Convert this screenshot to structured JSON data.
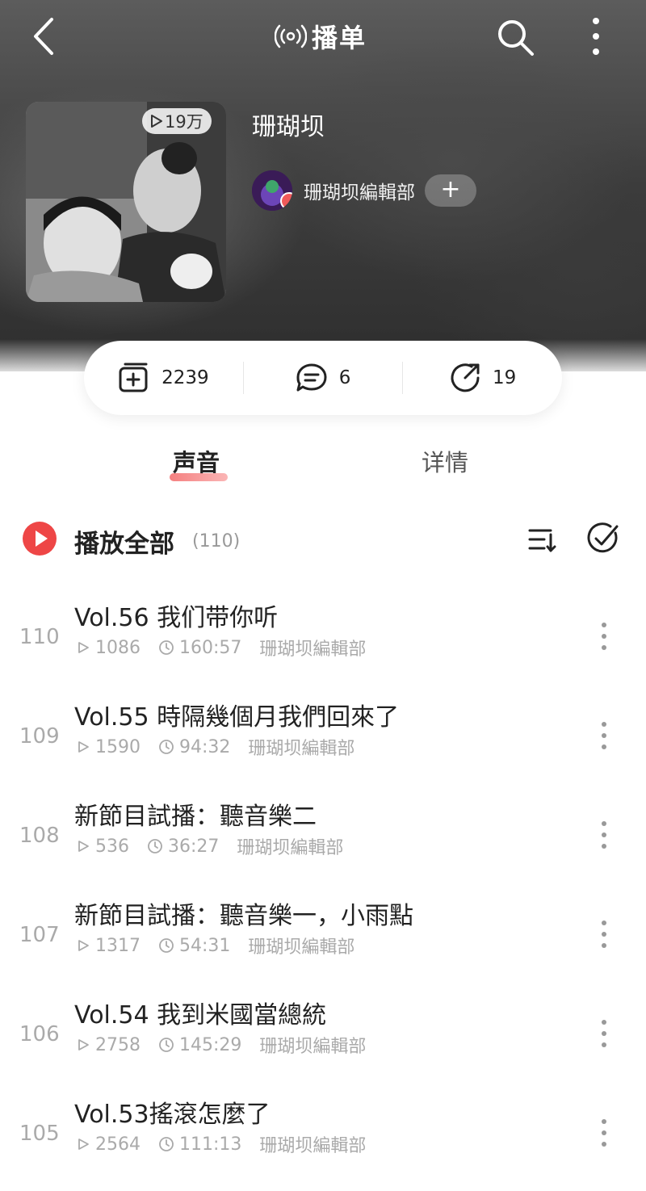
{
  "header": {
    "title": "播单"
  },
  "album": {
    "play_count": "19万",
    "name": "珊瑚坝",
    "author": "珊瑚坝編輯部",
    "follow_label": "+"
  },
  "stats": {
    "subscribe": "2239",
    "comments": "6",
    "shares": "19"
  },
  "tabs": [
    {
      "label": "声音"
    },
    {
      "label": "详情"
    }
  ],
  "play_all": {
    "label": "播放全部",
    "count": "(110)"
  },
  "tracks": [
    {
      "no": "110",
      "title": "Vol.56 我们带你听",
      "plays": "1086",
      "duration": "160:57",
      "author": "珊瑚坝編輯部"
    },
    {
      "no": "109",
      "title": "Vol.55 時隔幾個月我們回來了",
      "plays": "1590",
      "duration": "94:32",
      "author": "珊瑚坝編輯部"
    },
    {
      "no": "108",
      "title": "新節目試播：聽音樂二",
      "plays": "536",
      "duration": "36:27",
      "author": "珊瑚坝編輯部"
    },
    {
      "no": "107",
      "title": "新節目試播：聽音樂一，小雨點",
      "plays": "1317",
      "duration": "54:31",
      "author": "珊瑚坝編輯部"
    },
    {
      "no": "106",
      "title": "Vol.54 我到米國當總統",
      "plays": "2758",
      "duration": "145:29",
      "author": "珊瑚坝編輯部"
    },
    {
      "no": "105",
      "title": "Vol.53搖滾怎麼了",
      "plays": "2564",
      "duration": "111:13",
      "author": "珊瑚坝編輯部"
    }
  ],
  "colors": {
    "accent": "#ee4646",
    "muted": "#aaaaaa"
  }
}
